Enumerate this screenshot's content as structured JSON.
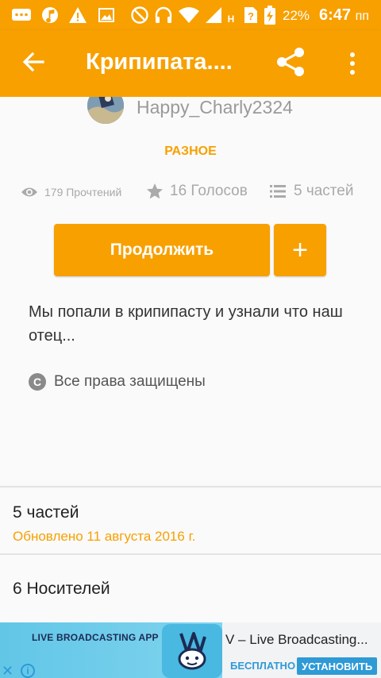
{
  "status_bar": {
    "battery_percent": "22%",
    "time": "6:47",
    "time_suffix": "пп",
    "network_label": "H",
    "icons": [
      "chat-icon",
      "music-icon",
      "warning-icon",
      "image-icon",
      "do-not-disturb-icon",
      "headphones-icon",
      "wifi-icon",
      "signal-icon",
      "sim-unknown-icon",
      "battery-charging-icon"
    ]
  },
  "app_bar": {
    "title": "Крипипата....",
    "icons": [
      "back-arrow-icon",
      "share-icon",
      "more-vert-icon"
    ]
  },
  "story": {
    "author": "Happy_Charly2324",
    "category": "РАЗНОЕ",
    "reads": "179 Прочтений",
    "votes": "16 Голосов",
    "parts": "5 частей",
    "continue_label": "Продолжить",
    "add_label": "+",
    "description": "Мы попали в крипипасту и узнали что наш отец...",
    "rights": "Все права защищены"
  },
  "sections": {
    "parts_title": "5 частей",
    "parts_updated": "Обновлено 11 августа 2016 г.",
    "media_title": "6 Носителей"
  },
  "ad": {
    "banner_text": "LIVE BROADCASTING APP",
    "title": "V – Live Broadcasting...",
    "free_label": "БЕСПЛАТНО",
    "install_label": "УСТАНОВИТЬ",
    "close_label": "✕",
    "info_label": "i"
  },
  "colors": {
    "accent": "#f7a000",
    "ad_blue": "#2e9ad6"
  }
}
